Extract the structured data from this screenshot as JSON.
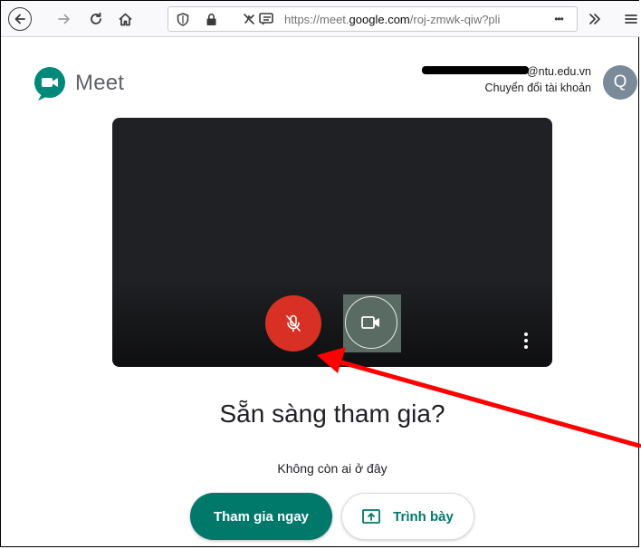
{
  "browser": {
    "url_prefix": "https://meet.",
    "url_host": "google.com",
    "url_path": "/roj-zmwk-qiw?pli",
    "url_more": "•••",
    "icons": [
      "back-icon",
      "forward-icon",
      "reload-icon",
      "home-icon",
      "shield-icon",
      "lock-icon",
      "permissions-icon",
      "overflow-icon",
      "menu-icon"
    ]
  },
  "header": {
    "app_name": "Meet",
    "account_email_suffix": "@ntu.edu.vn",
    "switch_account": "Chuyển đổi tài khoản",
    "avatar_letter": "Q"
  },
  "preview": {
    "mic_state": "muted",
    "colors": {
      "mic_muted": "#d93025",
      "background": "#202124"
    }
  },
  "join": {
    "title": "Sẵn sàng tham gia?",
    "status": "Không còn ai ở đây",
    "join_label": "Tham gia ngay",
    "present_label": "Trình bày",
    "accent": "#00796b"
  },
  "annotation": {
    "arrow_color": "#ff0000"
  }
}
